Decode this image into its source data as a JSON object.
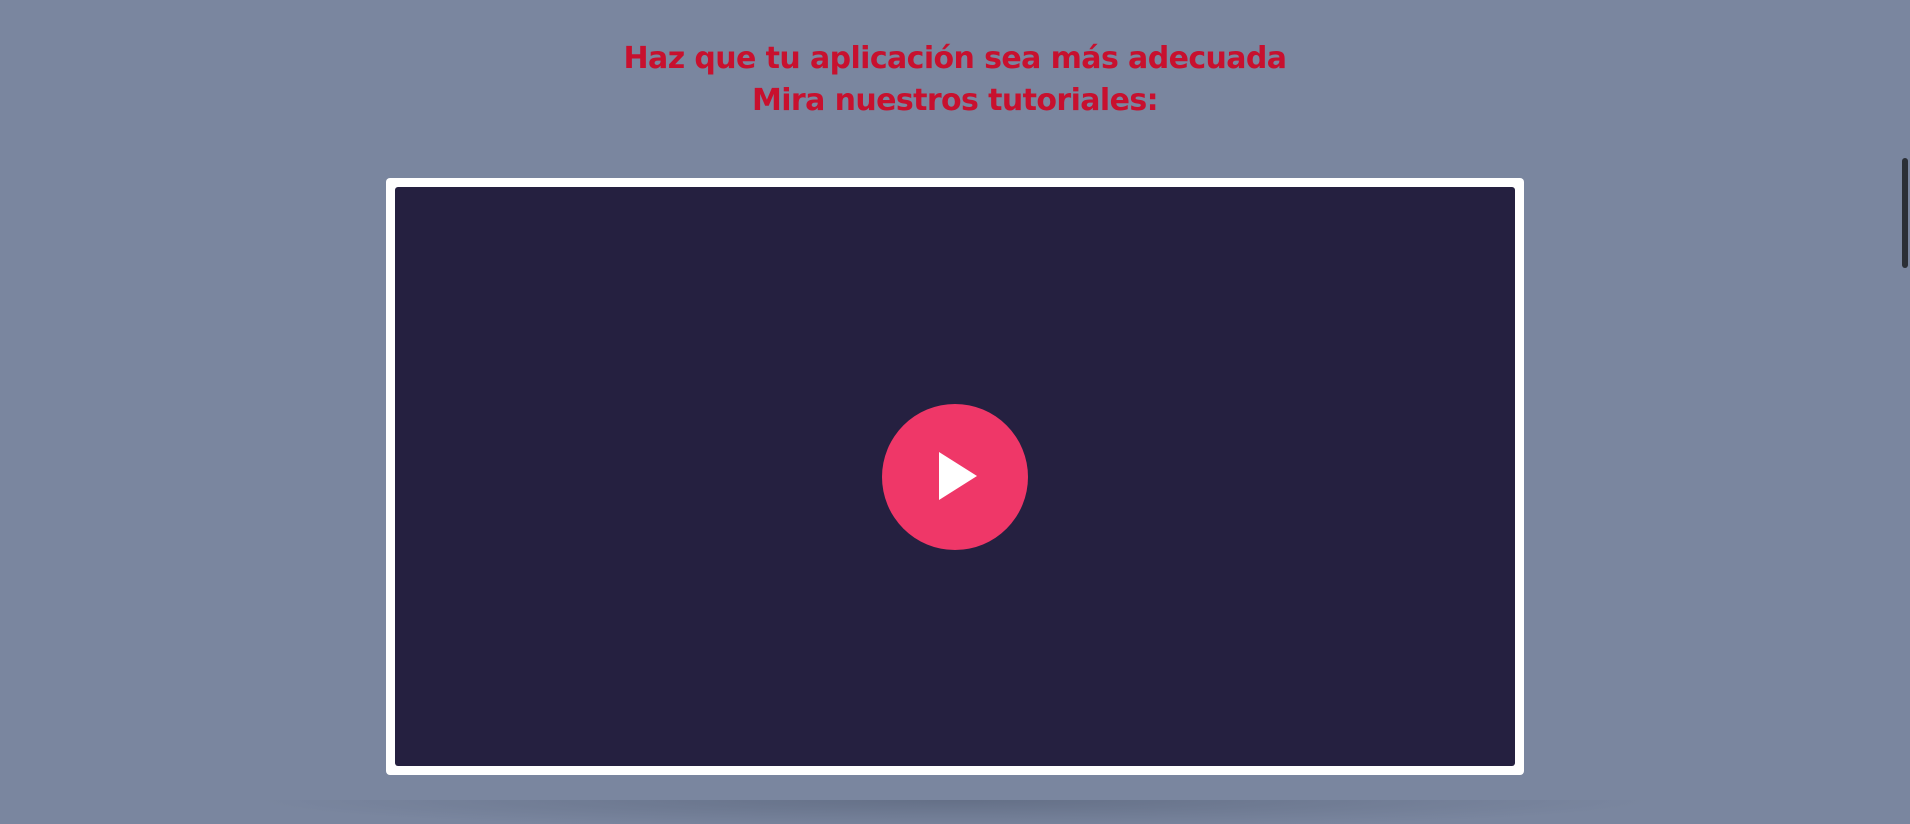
{
  "header": {
    "line1": "Haz que tu aplicación sea más adecuada",
    "line2": "Mira nuestros tutoriales:"
  },
  "video": {
    "play_icon": "play-icon",
    "frame_color": "#ffffff",
    "surface_color": "#252040",
    "button_color": "#ef3768"
  },
  "colors": {
    "background": "#7a869f",
    "heading": "#c8102e"
  }
}
